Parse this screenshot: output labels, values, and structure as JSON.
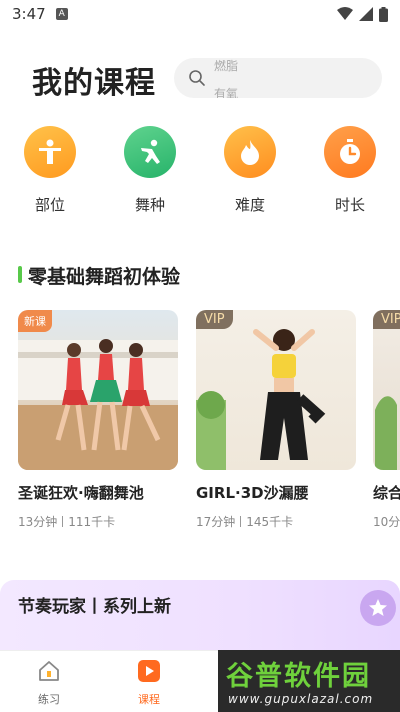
{
  "status": {
    "time": "3:47",
    "notif_icon": "A"
  },
  "header": {
    "title": "我的课程",
    "search_hint_1": "燃脂",
    "search_hint_2": "有氧"
  },
  "categories": [
    {
      "label": "部位",
      "icon": "body-part-icon",
      "color": "#ffab2e"
    },
    {
      "label": "舞种",
      "icon": "dance-type-icon",
      "color": "#3ec47a"
    },
    {
      "label": "难度",
      "icon": "flame-icon",
      "color": "#ffa12b"
    },
    {
      "label": "时长",
      "icon": "timer-icon",
      "color": "#ff8a2b"
    }
  ],
  "section1": {
    "title": "零基础舞蹈初体验",
    "cards": [
      {
        "badge": "新课",
        "title": "圣诞狂欢·嗨翻舞池",
        "duration": "13分钟",
        "calories": "111千卡"
      },
      {
        "badge": "VIP",
        "title": "GIRL·3D沙漏腰",
        "duration": "17分钟",
        "calories": "145千卡"
      },
      {
        "badge": "VIP",
        "title": "综合",
        "duration": "10分"
      }
    ]
  },
  "section2": {
    "title": "节奏玩家丨系列上新"
  },
  "nav": {
    "practice": "练习",
    "courses": "课程"
  },
  "watermark": {
    "text": "谷普软件园",
    "url": "www.gupuxlazal.com"
  },
  "colors": {
    "accent_green": "#58c94a",
    "nav_active": "#ff6a1f"
  }
}
